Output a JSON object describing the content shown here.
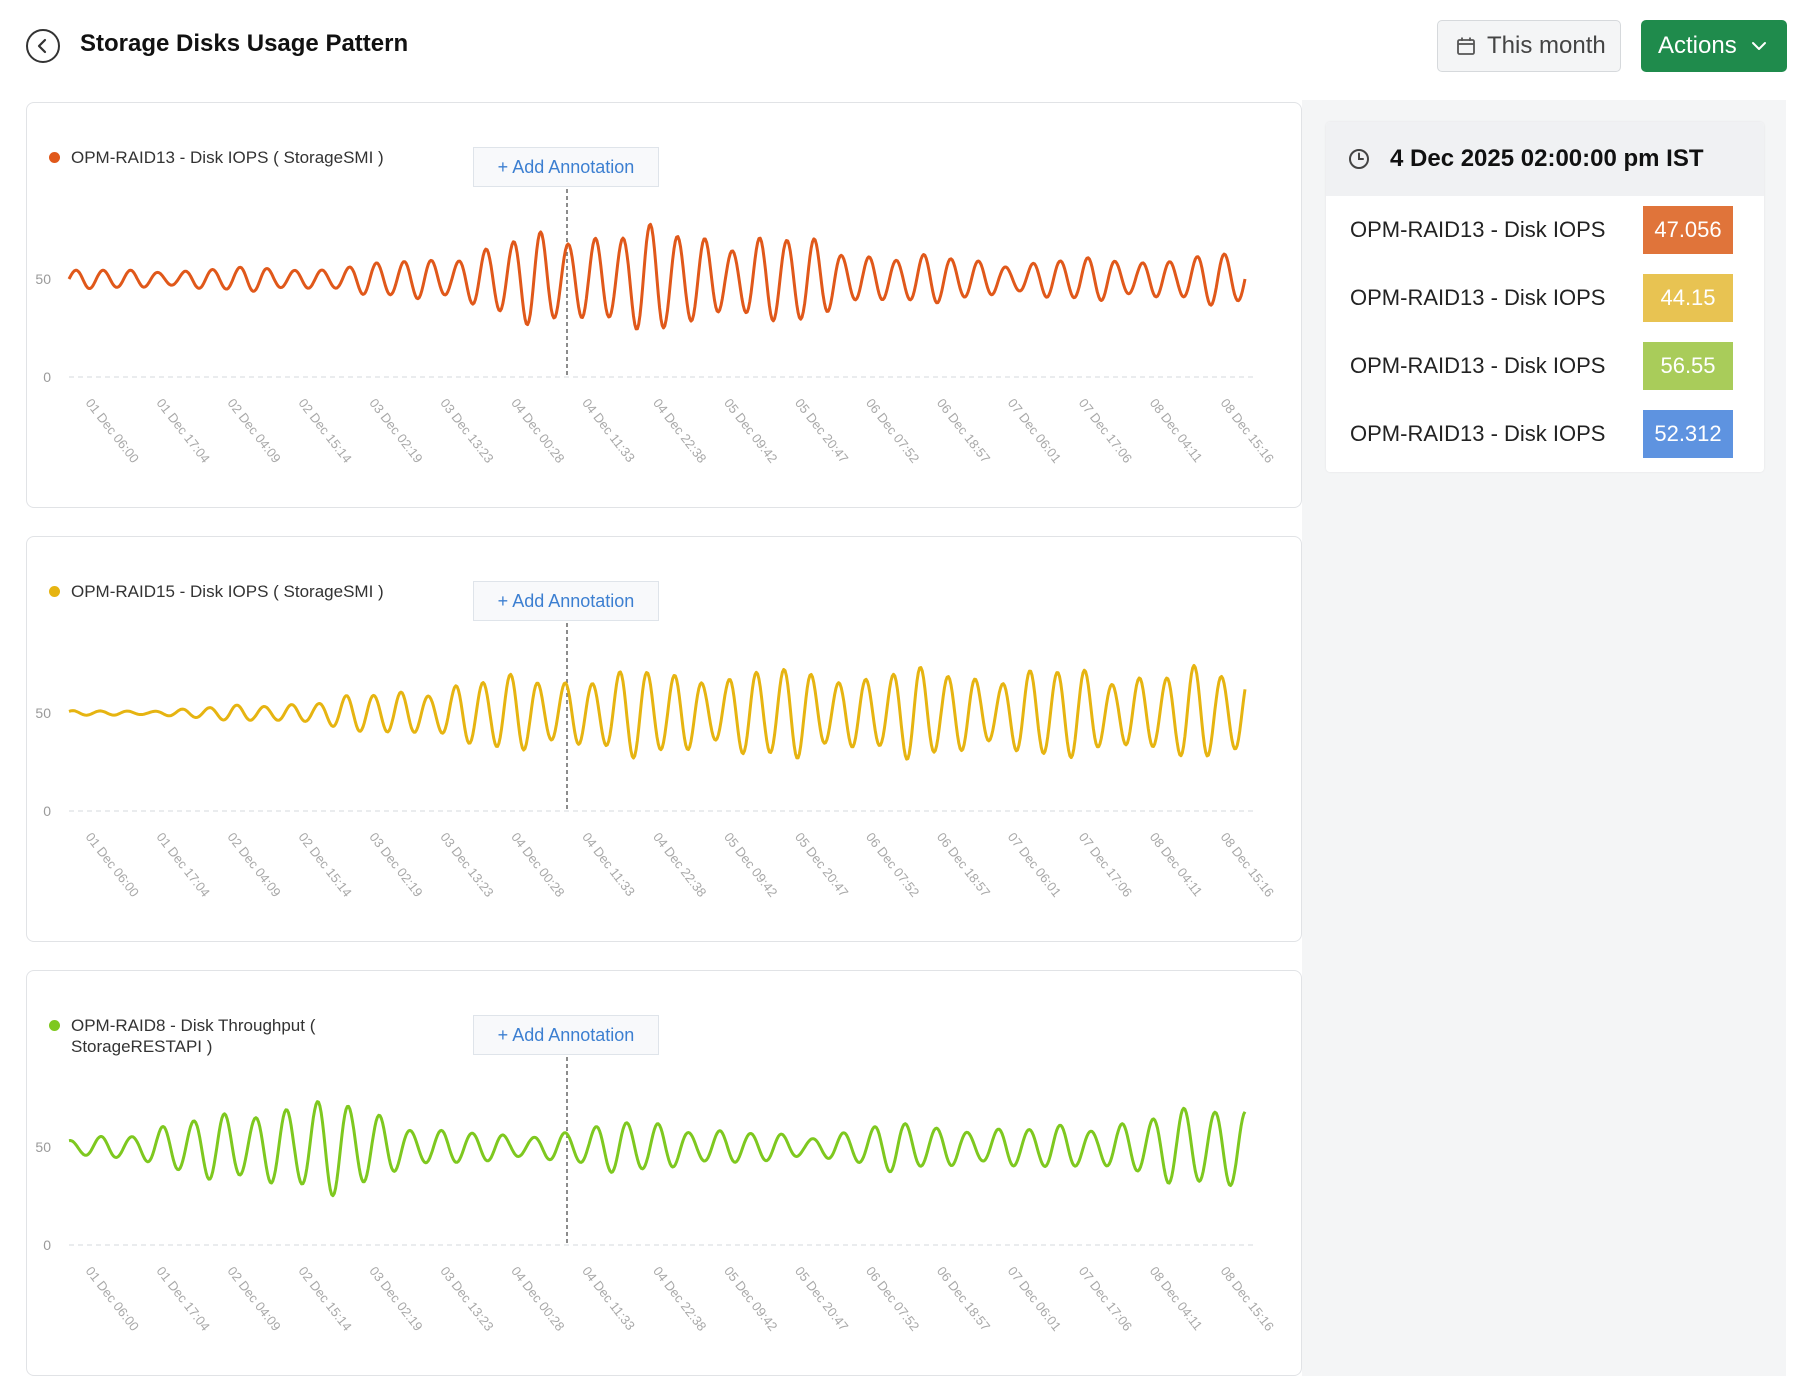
{
  "header": {
    "title": "Storage Disks Usage Pattern",
    "period_label": "This month",
    "actions_label": "Actions"
  },
  "annotation_label": "+ Add Annotation",
  "x_ticks": [
    "01 Dec 06:00",
    "01 Dec 17:04",
    "02 Dec 04:09",
    "02 Dec 15:14",
    "03 Dec 02:19",
    "03 Dec 13:23",
    "04 Dec 00:28",
    "04 Dec 11:33",
    "04 Dec 22:38",
    "05 Dec 09:42",
    "05 Dec 20:47",
    "06 Dec 07:52",
    "06 Dec 18:57",
    "07 Dec 06:01",
    "07 Dec 17:06",
    "08 Dec 04:11",
    "08 Dec 15:16"
  ],
  "charts": [
    {
      "legend": "OPM-RAID13 - Disk IOPS ( StorageSMI )",
      "color": "#e0581a",
      "y_ticks": [
        "50",
        "0"
      ],
      "cursor_x": "04 Dec 02:00"
    },
    {
      "legend": "OPM-RAID15 - Disk IOPS ( StorageSMI )",
      "color": "#e6b411",
      "y_ticks": [
        "50",
        "0"
      ],
      "cursor_x": "04 Dec 02:00"
    },
    {
      "legend": "OPM-RAID8 - Disk Throughput ( StorageRESTAPI )",
      "color": "#7ec81f",
      "y_ticks": [
        "50",
        "0"
      ],
      "cursor_x": "04 Dec 02:00"
    }
  ],
  "chart_data": [
    {
      "type": "line",
      "series": [
        {
          "name": "OPM-RAID13 - Disk IOPS ( StorageSMI )",
          "color": "#e0581a"
        }
      ],
      "x_start": "01 Dec 06:00",
      "x_end": "08 Dec 15:16",
      "ylim": [
        0,
        100
      ],
      "amplitude": [
        4,
        4,
        5,
        5,
        7,
        12,
        20,
        24,
        20,
        20,
        13,
        10,
        8,
        9,
        10,
        11
      ],
      "baseline": 50,
      "cycles": 43
    },
    {
      "type": "line",
      "series": [
        {
          "name": "OPM-RAID15 - Disk IOPS ( StorageSMI )",
          "color": "#e6b411"
        }
      ],
      "x_start": "01 Dec 06:00",
      "x_end": "08 Dec 15:16",
      "ylim": [
        0,
        100
      ],
      "amplitude": [
        1,
        1,
        3,
        5,
        9,
        14,
        17,
        18,
        19,
        19,
        19,
        19,
        19,
        19,
        19,
        19
      ],
      "baseline": 50,
      "cycles": 43
    },
    {
      "type": "line",
      "series": [
        {
          "name": "OPM-RAID8 - Disk Throughput ( StorageRESTAPI )",
          "color": "#7ec81f"
        }
      ],
      "x_start": "01 Dec 06:00",
      "x_end": "08 Dec 15:16",
      "ylim": [
        0,
        100
      ],
      "amplitude": [
        3,
        8,
        14,
        22,
        18,
        8,
        5,
        9,
        12,
        7,
        5,
        10,
        10,
        8,
        11,
        15,
        22
      ],
      "baseline": 50,
      "cycles": 38
    }
  ],
  "tooltip": {
    "time": "4 Dec 2025 02:00:00 pm IST",
    "rows": [
      {
        "label": "OPM-RAID13 - Disk IOPS",
        "value": "47.056",
        "color": "#e0743a"
      },
      {
        "label": "OPM-RAID13 - Disk IOPS",
        "value": "44.15",
        "color": "#e8c352"
      },
      {
        "label": "OPM-RAID13 - Disk IOPS",
        "value": "56.55",
        "color": "#a9cc5a"
      },
      {
        "label": "OPM-RAID13 - Disk IOPS",
        "value": "52.312",
        "color": "#5e93e0"
      }
    ]
  }
}
